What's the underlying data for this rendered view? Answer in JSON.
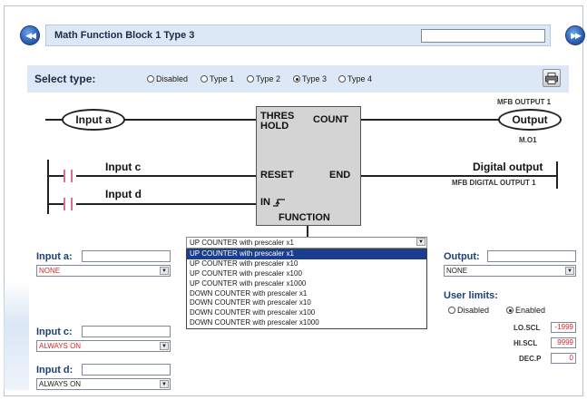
{
  "header": {
    "title": "Math Function Block 1 Type 3",
    "prev_icon": "rewind-icon",
    "next_icon": "fast-forward-icon",
    "field_value": ""
  },
  "type_select": {
    "label": "Select type:",
    "options": [
      "Disabled",
      "Type 1",
      "Type 2",
      "Type 3",
      "Type 4"
    ],
    "selected": "Type 3",
    "print_icon": "printer-icon"
  },
  "diagram": {
    "input_a": "Input a",
    "output": "Output",
    "mfb_output_top": "MFB OUTPUT 1",
    "output_addr": "M.O1",
    "input_c": "Input c",
    "input_d": "Input d",
    "digital_output": "Digital output",
    "mfb_digital_output": "MFB DIGITAL OUTPUT 1",
    "block": {
      "threshold_line1": "THRES",
      "threshold_line2": "HOLD",
      "count": "COUNT",
      "reset": "RESET",
      "end": "END",
      "in": "IN",
      "function": "FUNCTION"
    }
  },
  "function_dropdown": {
    "value": "UP COUNTER with prescaler x1",
    "options": [
      "UP COUNTER with prescaler x1",
      "UP COUNTER with prescaler x10",
      "UP COUNTER with prescaler x100",
      "UP COUNTER with prescaler x1000",
      "DOWN COUNTER with prescaler x1",
      "DOWN COUNTER with prescaler x10",
      "DOWN COUNTER with prescaler x100",
      "DOWN COUNTER with prescaler x1000"
    ],
    "highlighted_index": 0
  },
  "left_panel": {
    "input_a_label": "Input a:",
    "input_a_text": "",
    "input_a_select": "NONE",
    "input_c_label": "Input c:",
    "input_c_text": "",
    "input_c_select": "ALWAYS ON",
    "input_d_label": "Input d:",
    "input_d_text": "",
    "input_d_select": "ALWAYS ON"
  },
  "right_panel": {
    "output_label": "Output:",
    "output_text": "",
    "output_select": "NONE",
    "user_limits_label": "User limits:",
    "limit_options": [
      "Disabled",
      "Enabled"
    ],
    "limit_selected": "Enabled",
    "lo_scl_label": "LO.SCL",
    "lo_scl_value": "-1999",
    "hi_scl_label": "HI.SCL",
    "hi_scl_value": "9999",
    "dec_p_label": "DEC.P",
    "dec_p_value": "0"
  },
  "colors": {
    "band": "#dde8f6",
    "label_blue": "#1c3f77",
    "red_value": "#d9262b",
    "highlight": "#1a3d8f"
  }
}
